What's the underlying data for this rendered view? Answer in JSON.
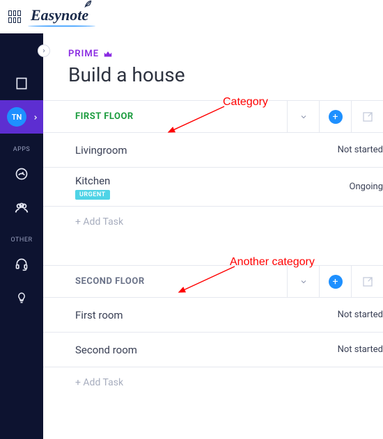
{
  "logo_text": "Easynote",
  "sidebar": {
    "active_avatar": "TN",
    "label_apps": "APPS",
    "label_other": "OTHER"
  },
  "header": {
    "prime_label": "PRIME",
    "title": "Build a house"
  },
  "annotations": {
    "a1": "Category",
    "a2": "Another category"
  },
  "categories": [
    {
      "name": "FIRST FLOOR",
      "color": "green",
      "tasks": [
        {
          "name": "Livingroom",
          "status": "Not started",
          "urgent": false
        },
        {
          "name": "Kitchen",
          "status": "Ongoing",
          "urgent": true
        }
      ],
      "add_label": "+ Add Task",
      "urgent_label": "URGENT"
    },
    {
      "name": "SECOND FLOOR",
      "color": "gray",
      "tasks": [
        {
          "name": "First room",
          "status": "Not started",
          "urgent": false
        },
        {
          "name": "Second room",
          "status": "Not started",
          "urgent": false
        }
      ],
      "add_label": "+ Add Task"
    }
  ]
}
